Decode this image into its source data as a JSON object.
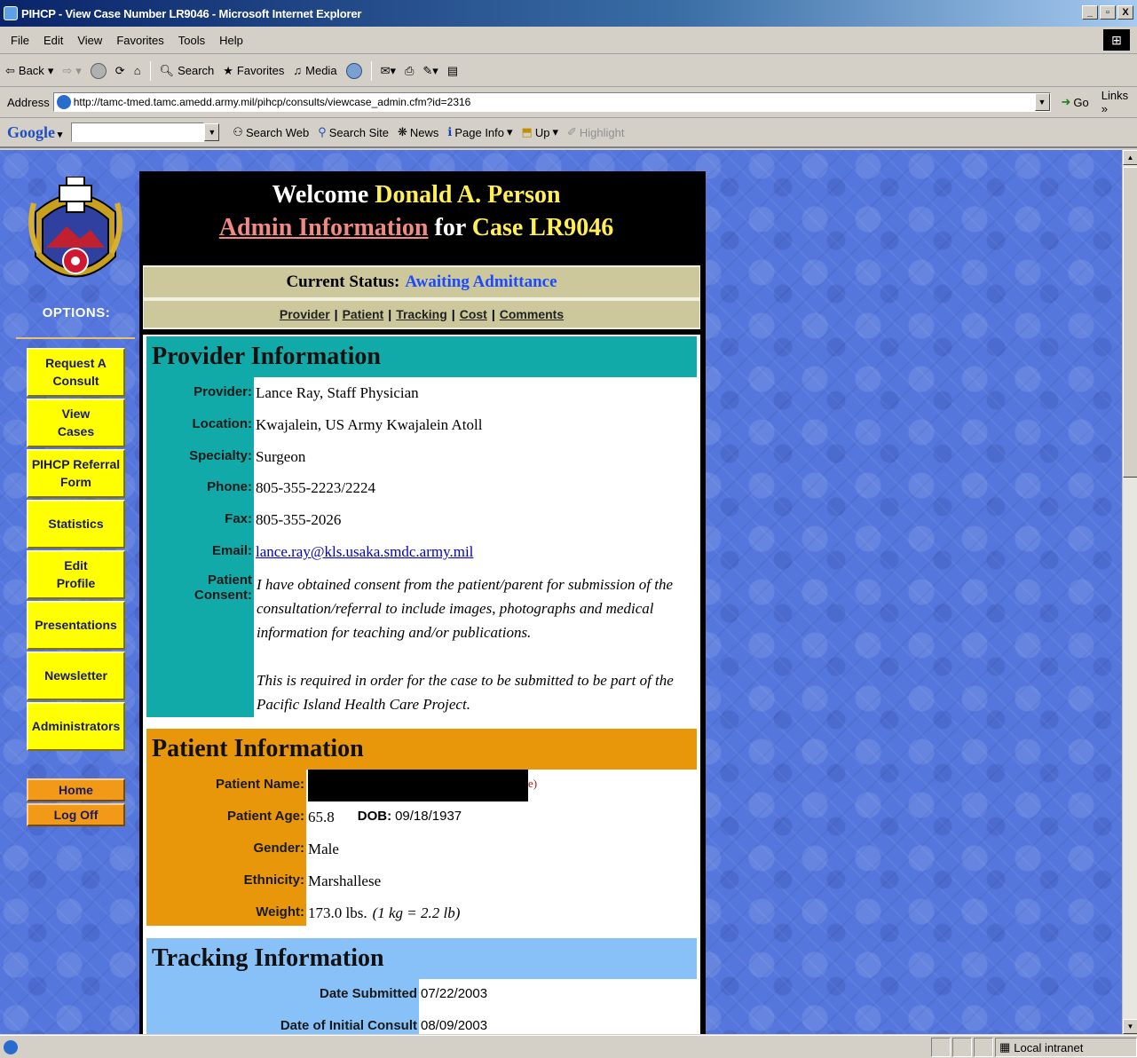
{
  "window": {
    "title": "PIHCP - View Case Number LR9046 - Microsoft Internet Explorer",
    "buttons": [
      "_",
      "▫",
      "X"
    ]
  },
  "menu": [
    "File",
    "Edit",
    "View",
    "Favorites",
    "Tools",
    "Help"
  ],
  "toolbar": {
    "back": "Back",
    "search": "Search",
    "favorites": "Favorites",
    "media": "Media"
  },
  "address": {
    "label": "Address",
    "url": "http://tamc-tmed.tamc.amedd.army.mil/pihcp/consults/viewcase_admin.cfm?id=2316",
    "go": "Go",
    "links": "Links »"
  },
  "google": {
    "logo": "Google",
    "search_web": "Search Web",
    "search_site": "Search Site",
    "news": "News",
    "page_info": "Page Info",
    "up": "Up",
    "highlight": "Highlight"
  },
  "sidebar": {
    "options_label": "OPTIONS:",
    "nav": [
      {
        "line1": "Request A",
        "line2": "Consult"
      },
      {
        "line1": "View",
        "line2": "Cases"
      },
      {
        "line1": "PIHCP Referral",
        "line2": "Form"
      },
      {
        "line1": "Statistics",
        "line2": ""
      },
      {
        "line1": "Edit",
        "line2": "Profile"
      },
      {
        "line1": "Presentations",
        "line2": ""
      },
      {
        "line1": "Newsletter",
        "line2": ""
      },
      {
        "line1": "Administrators",
        "line2": ""
      }
    ],
    "home": "Home",
    "logoff": "Log Off"
  },
  "header": {
    "welcome": "Welcome",
    "user": "Donald A. Person",
    "admin_link": "Admin Information",
    "for": "for",
    "case": "Case LR9046"
  },
  "status": {
    "label": "Current Status:",
    "value": "Awaiting Admittance"
  },
  "section_links": [
    "Provider",
    "Patient",
    "Tracking",
    "Cost",
    "Comments"
  ],
  "provider": {
    "heading": "Provider Information",
    "rows": [
      {
        "label": "Provider:",
        "value": "Lance Ray, Staff Physician"
      },
      {
        "label": "Location:",
        "value": "Kwajalein, US Army Kwajalein Atoll"
      },
      {
        "label": "Specialty:",
        "value": "Surgeon"
      },
      {
        "label": "Phone:",
        "value": "805-355-2223/2224"
      },
      {
        "label": "Fax:",
        "value": "805-355-2026"
      },
      {
        "label": "Email:",
        "value": "lance.ray@kls.usaka.smdc.army.mil"
      }
    ],
    "consent_label": "Patient Consent:",
    "consent_p1": "I have obtained consent from the patient/parent for submission of the consultation/referral to include images, photographs and medical information for teaching and/or publications.",
    "consent_p2": "This is required in order for the case to be submitted to be part of the Pacific Island Health Care Project."
  },
  "patient": {
    "heading": "Patient Information",
    "name_label": "Patient Name:",
    "name_suffix": "e)",
    "age_label": "Patient Age:",
    "age": "65.8",
    "dob_label": "DOB:",
    "dob": "09/18/1937",
    "gender_label": "Gender:",
    "gender": "Male",
    "ethnicity_label": "Ethnicity:",
    "ethnicity": "Marshallese",
    "weight_label": "Weight:",
    "weight": "173.0 lbs.",
    "weight_note": "(1 kg = 2.2 lb)"
  },
  "tracking": {
    "heading": "Tracking Information",
    "submitted_label": "Date Submitted",
    "submitted": "07/22/2003",
    "initial_label": "Date of Initial Consult",
    "initial": "08/09/2003"
  },
  "statusbar": {
    "zone": "Local intranet"
  },
  "colors": {
    "provider_band": "#12aaa8",
    "patient_band": "#e8960a",
    "tracking_band": "#88c0f8",
    "nav_button": "#ffff00",
    "home_button": "#f29a18",
    "status_value": "#1b4bff"
  }
}
